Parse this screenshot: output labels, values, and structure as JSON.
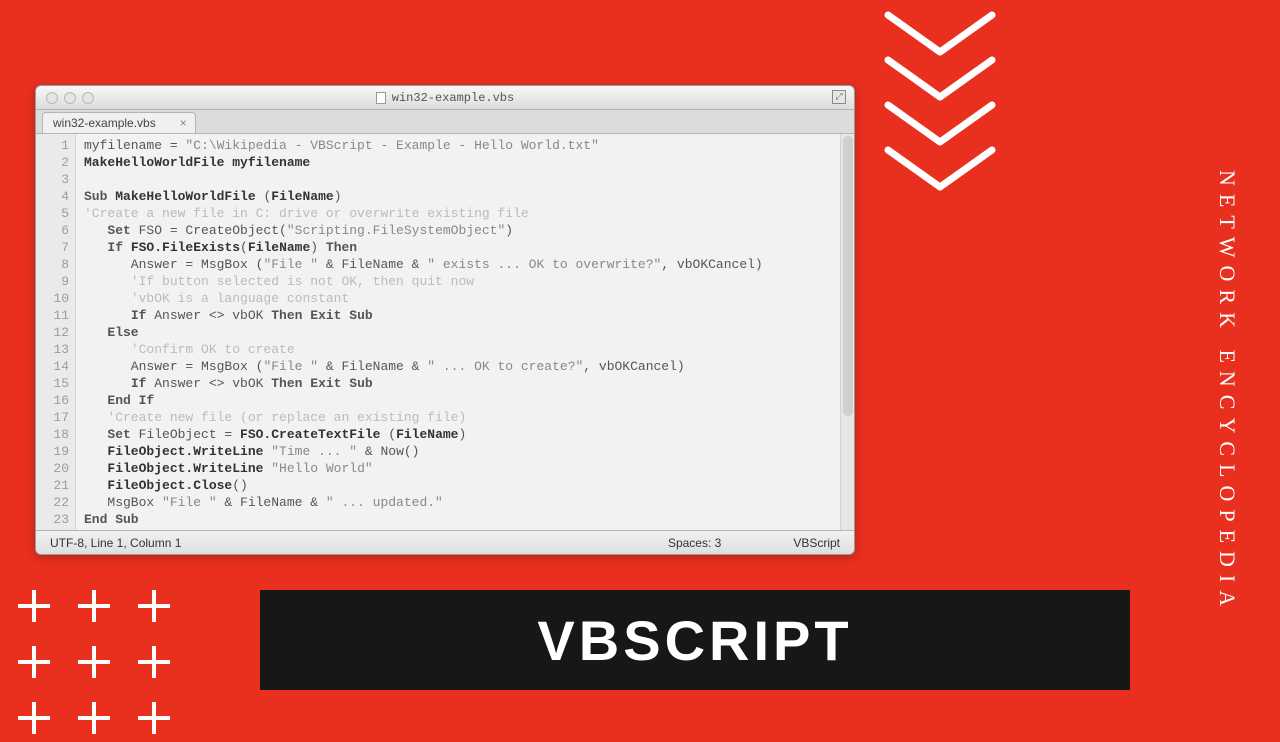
{
  "page": {
    "banner": "VBSCRIPT",
    "side_label": "NETWORK ENCYCLOPEDIA"
  },
  "window": {
    "title": "win32-example.vbs",
    "tab_label": "win32-example.vbs",
    "status": {
      "encoding_pos": "UTF-8, Line 1, Column 1",
      "indent": "Spaces: 3",
      "language": "VBScript"
    }
  },
  "code": {
    "lines": [
      {
        "n": 1,
        "segs": [
          [
            "txt",
            "myfilename = "
          ],
          [
            "str",
            "\"C:\\Wikipedia - VBScript - Example - Hello World.txt\""
          ]
        ]
      },
      {
        "n": 2,
        "segs": [
          [
            "b",
            "MakeHelloWorldFile myfilename"
          ]
        ]
      },
      {
        "n": 3,
        "segs": [
          [
            "txt",
            ""
          ]
        ]
      },
      {
        "n": 4,
        "segs": [
          [
            "kw",
            "Sub"
          ],
          [
            "txt",
            " "
          ],
          [
            "b",
            "MakeHelloWorldFile"
          ],
          [
            "txt",
            " ("
          ],
          [
            "b",
            "FileName"
          ],
          [
            "txt",
            ")"
          ]
        ]
      },
      {
        "n": 5,
        "segs": [
          [
            "cmt",
            "'Create a new file in C: drive or overwrite existing file"
          ]
        ]
      },
      {
        "n": 6,
        "segs": [
          [
            "txt",
            "   "
          ],
          [
            "kw",
            "Set"
          ],
          [
            "txt",
            " FSO = CreateObject("
          ],
          [
            "str",
            "\"Scripting.FileSystemObject\""
          ],
          [
            "txt",
            ")"
          ]
        ]
      },
      {
        "n": 7,
        "segs": [
          [
            "txt",
            "   "
          ],
          [
            "kw",
            "If"
          ],
          [
            "txt",
            " "
          ],
          [
            "b",
            "FSO.FileExists"
          ],
          [
            "txt",
            "("
          ],
          [
            "b",
            "FileName"
          ],
          [
            "txt",
            ") "
          ],
          [
            "kw",
            "Then"
          ]
        ]
      },
      {
        "n": 8,
        "segs": [
          [
            "txt",
            "      Answer = MsgBox ("
          ],
          [
            "str",
            "\"File \""
          ],
          [
            "txt",
            " & FileName & "
          ],
          [
            "str",
            "\" exists ... OK to overwrite?\""
          ],
          [
            "txt",
            ", vbOKCancel)"
          ]
        ]
      },
      {
        "n": 9,
        "segs": [
          [
            "txt",
            "      "
          ],
          [
            "cmt",
            "'If button selected is not OK, then quit now"
          ]
        ]
      },
      {
        "n": 10,
        "segs": [
          [
            "txt",
            "      "
          ],
          [
            "cmt",
            "'vbOK is a language constant"
          ]
        ]
      },
      {
        "n": 11,
        "segs": [
          [
            "txt",
            "      "
          ],
          [
            "kw",
            "If"
          ],
          [
            "txt",
            " Answer <> vbOK "
          ],
          [
            "kw",
            "Then"
          ],
          [
            "txt",
            " "
          ],
          [
            "kw",
            "Exit Sub"
          ]
        ]
      },
      {
        "n": 12,
        "segs": [
          [
            "txt",
            "   "
          ],
          [
            "kw",
            "Else"
          ]
        ]
      },
      {
        "n": 13,
        "segs": [
          [
            "txt",
            "      "
          ],
          [
            "cmt",
            "'Confirm OK to create"
          ]
        ]
      },
      {
        "n": 14,
        "segs": [
          [
            "txt",
            "      Answer = MsgBox ("
          ],
          [
            "str",
            "\"File \""
          ],
          [
            "txt",
            " & FileName & "
          ],
          [
            "str",
            "\" ... OK to create?\""
          ],
          [
            "txt",
            ", vbOKCancel)"
          ]
        ]
      },
      {
        "n": 15,
        "segs": [
          [
            "txt",
            "      "
          ],
          [
            "kw",
            "If"
          ],
          [
            "txt",
            " Answer <> vbOK "
          ],
          [
            "kw",
            "Then"
          ],
          [
            "txt",
            " "
          ],
          [
            "kw",
            "Exit Sub"
          ]
        ]
      },
      {
        "n": 16,
        "segs": [
          [
            "txt",
            "   "
          ],
          [
            "kw",
            "End If"
          ]
        ]
      },
      {
        "n": 17,
        "segs": [
          [
            "txt",
            "   "
          ],
          [
            "cmt",
            "'Create new file (or replace an existing file)"
          ]
        ]
      },
      {
        "n": 18,
        "segs": [
          [
            "txt",
            "   "
          ],
          [
            "kw",
            "Set"
          ],
          [
            "txt",
            " FileObject = "
          ],
          [
            "b",
            "FSO.CreateTextFile"
          ],
          [
            "txt",
            " ("
          ],
          [
            "b",
            "FileName"
          ],
          [
            "txt",
            ")"
          ]
        ]
      },
      {
        "n": 19,
        "segs": [
          [
            "txt",
            "   "
          ],
          [
            "b",
            "FileObject.WriteLine"
          ],
          [
            "txt",
            " "
          ],
          [
            "str",
            "\"Time ... \""
          ],
          [
            "txt",
            " & Now()"
          ]
        ]
      },
      {
        "n": 20,
        "segs": [
          [
            "txt",
            "   "
          ],
          [
            "b",
            "FileObject.WriteLine"
          ],
          [
            "txt",
            " "
          ],
          [
            "str",
            "\"Hello World\""
          ]
        ]
      },
      {
        "n": 21,
        "segs": [
          [
            "txt",
            "   "
          ],
          [
            "b",
            "FileObject.Close"
          ],
          [
            "txt",
            "()"
          ]
        ]
      },
      {
        "n": 22,
        "segs": [
          [
            "txt",
            "   MsgBox "
          ],
          [
            "str",
            "\"File \""
          ],
          [
            "txt",
            " & FileName & "
          ],
          [
            "str",
            "\" ... updated.\""
          ]
        ]
      },
      {
        "n": 23,
        "segs": [
          [
            "kw",
            "End Sub"
          ]
        ]
      }
    ]
  }
}
